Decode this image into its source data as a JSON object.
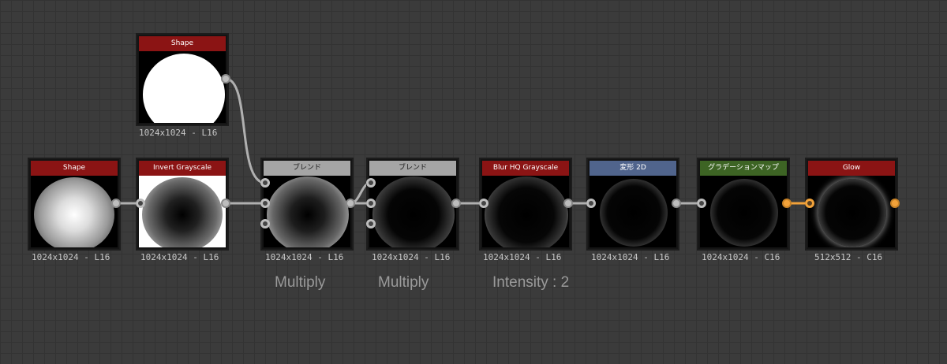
{
  "colors": {
    "red_header": "#8b1414",
    "gray_header": "#a5a5a5",
    "blue_header": "#50648c",
    "green_header": "#3d6424",
    "wire_gray": "#b0b0b0",
    "wire_color": "#f2a23a"
  },
  "nodes": {
    "shape_top": {
      "title": "Shape",
      "res": "1024x1024 - L16"
    },
    "shape": {
      "title": "Shape",
      "res": "1024x1024 - L16"
    },
    "invert": {
      "title": "Invert Grayscale",
      "res": "1024x1024 - L16"
    },
    "blend1": {
      "title": "ブレンド",
      "res": "1024x1024 - L16"
    },
    "blend2": {
      "title": "ブレンド",
      "res": "1024x1024 - L16"
    },
    "blur": {
      "title": "Blur HQ Grayscale",
      "res": "1024x1024 - L16"
    },
    "transform": {
      "title": "変形 2D",
      "res": "1024x1024 - L16"
    },
    "gradient": {
      "title": "グラデーションマップ",
      "res": "1024x1024 - C16"
    },
    "glow": {
      "title": "Glow",
      "res": "512x512 - C16"
    }
  },
  "comments": {
    "blend1": "Multiply",
    "blend2": "Multiply",
    "blur": "Intensity : 2"
  }
}
